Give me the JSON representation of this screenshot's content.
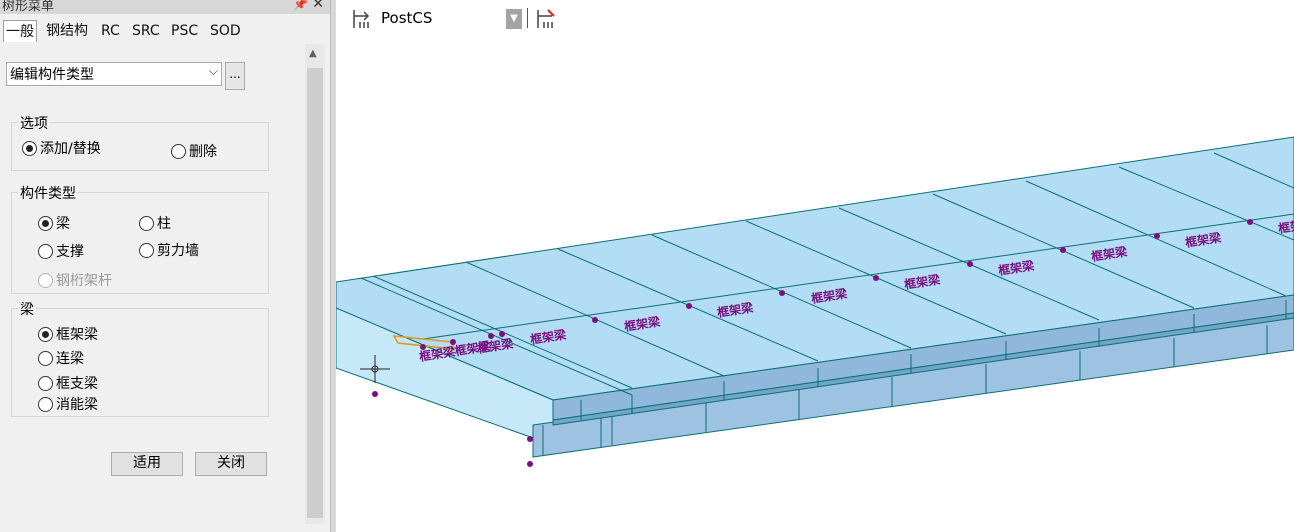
{
  "panel": {
    "title": "树形菜单",
    "tabs": [
      "一般",
      "钢结构",
      "RC",
      "SRC",
      "PSC",
      "SOD"
    ],
    "active_tab": "一般",
    "dropdown_value": "编辑构件类型",
    "dots_label": "...",
    "options_group": {
      "label": "选项",
      "add_replace": "添加/替换",
      "delete": "删除"
    },
    "member_type_group": {
      "label": "构件类型",
      "beam": "梁",
      "column": "柱",
      "brace": "支撑",
      "shear_wall": "剪力墙",
      "truss": "钢桁架杆"
    },
    "beam_group": {
      "label": "梁",
      "frame_beam": "框架梁",
      "coupling_beam": "连梁",
      "transfer_beam": "框支梁",
      "energy_beam": "消能梁"
    },
    "apply_button": "适用",
    "close_button": "关闭"
  },
  "viewport": {
    "coordinate_system": "PostCS",
    "beam_label": "框架梁",
    "beam_label_overlap": "框架梁框架梁",
    "label_colors": {
      "member": "#7a1080",
      "slab": "#b3dcf5",
      "edge": "#0b6f72"
    }
  }
}
